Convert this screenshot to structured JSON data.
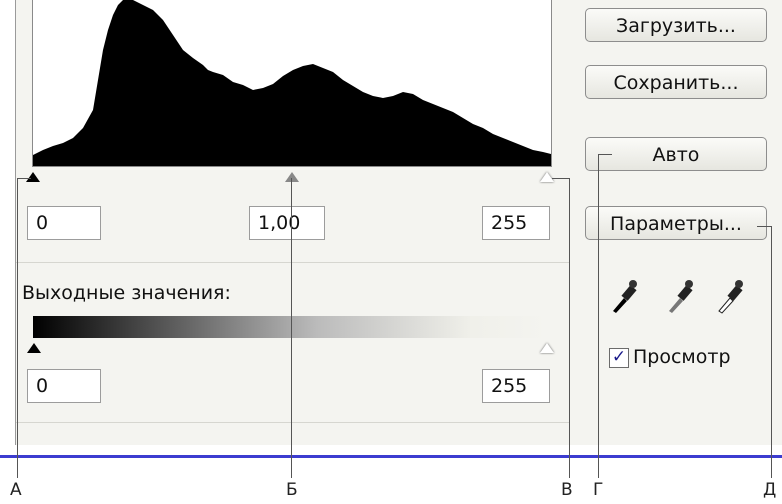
{
  "input_levels": {
    "black": "0",
    "gamma": "1,00",
    "white": "255"
  },
  "output_label": "Выходные значения:",
  "output_levels": {
    "black": "0",
    "white": "255"
  },
  "buttons": {
    "load": "Загрузить...",
    "save": "Сохранить...",
    "auto": "Авто",
    "options": "Параметры..."
  },
  "preview": {
    "label": "Просмотр",
    "checked": true
  },
  "callouts": [
    "А",
    "Б",
    "В",
    "Г",
    "Д"
  ],
  "icons": [
    "black-eyedropper-icon",
    "gray-eyedropper-icon",
    "white-eyedropper-icon"
  ],
  "colors": {
    "baseline": "#3c3cd0",
    "panel": "#f4f4f0"
  }
}
